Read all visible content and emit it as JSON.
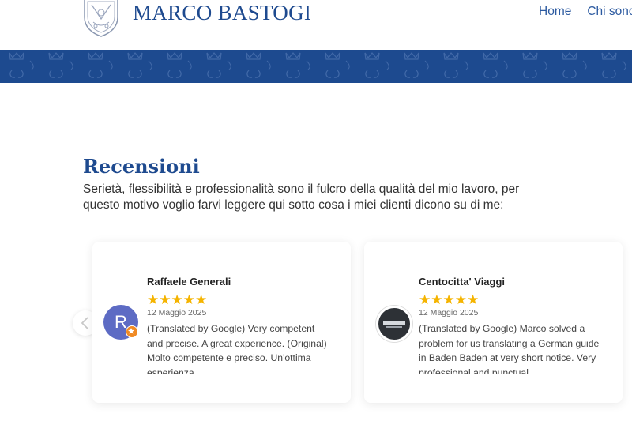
{
  "header": {
    "brand": "MARCO BASTOGI",
    "nav": [
      "Home",
      "Chi sono"
    ]
  },
  "section": {
    "title": "Recensioni",
    "description": "Serietà, flessibilità e professionalità sono il fulcro della qualità del mio lavoro, per questo motivo voglio farvi leggere qui sotto cosa i miei clienti dicono su di me:"
  },
  "reviews": [
    {
      "name": "Raffaele Generali",
      "avatar_letter": "R",
      "stars": "★★★★★",
      "date": "12 Maggio 2025",
      "text": "(Translated by Google) Very competent and precise. A great experience. (Original) Molto competente e preciso. Un'ottima esperienza."
    },
    {
      "name": "Centocitta' Viaggi",
      "stars": "★★★★★",
      "date": "12 Maggio 2025",
      "text": "(Translated by Google) Marco solved a problem for us translating a German guide in Baden Baden at very short notice. Very professional and punctual."
    }
  ],
  "colors": {
    "brand_blue": "#1e4a8f",
    "band_blue": "#1d4a8f",
    "star_yellow": "#f5b400"
  }
}
